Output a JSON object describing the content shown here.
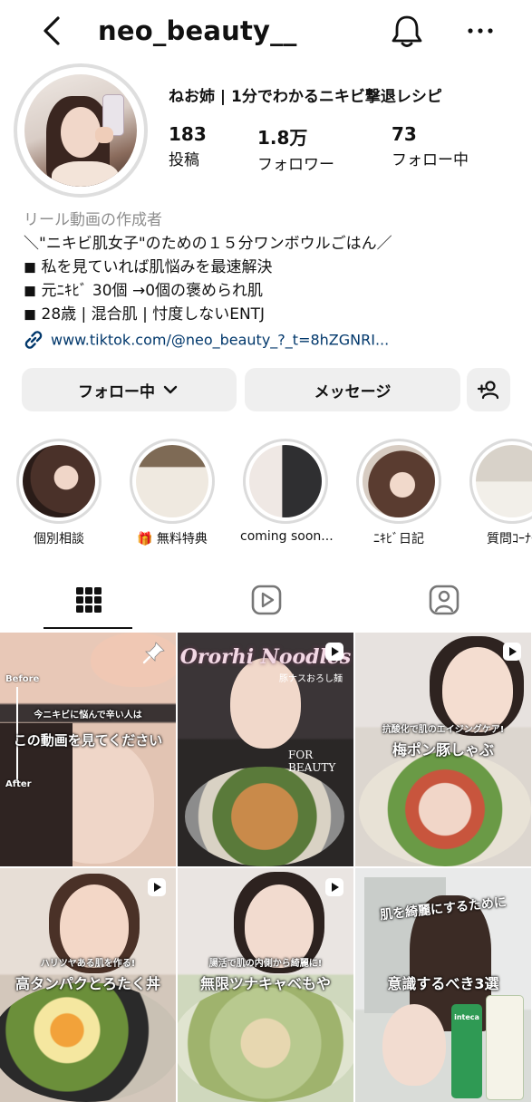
{
  "header": {
    "username": "neo_beauty__"
  },
  "profile": {
    "display_name": "ねお姉 | 1分でわかるニキビ撃退レシピ",
    "stats": [
      {
        "value": "183",
        "label": "投稿"
      },
      {
        "value": "1.8万",
        "label": "フォロワー"
      },
      {
        "value": "73",
        "label": "フォロー中"
      }
    ],
    "category": "リール動画の作成者",
    "bio_lines": [
      "＼\"ニキビ肌女子\"のための１５分ワンボウルごはん／",
      "◼︎ 私を見ていれば肌悩みを最速解決",
      "◼︎ 元ﾆｷﾋﾞ 30個 →0個の褒められ肌",
      "◼︎ 28歳 | 混合肌 | 忖度しないENTJ"
    ],
    "link": "www.tiktok.com/@neo_beauty_?_t=8hZGNRI..."
  },
  "buttons": {
    "following": "フォロー中",
    "message": "メッセージ"
  },
  "highlights": [
    {
      "label": "個別相談"
    },
    {
      "label": "🎁 無料特典"
    },
    {
      "label": "coming soon..."
    },
    {
      "label": "ﾆｷﾋﾞ日記"
    },
    {
      "label": "質問ｺｰﾅｰ"
    }
  ],
  "grid": [
    {
      "texts": [
        "Before",
        "今ニキビに悩んで辛い人は",
        "この動画を見てください",
        "After"
      ]
    },
    {
      "texts": [
        "Ororhi Noodles",
        "豚ナスおろし麺",
        "FOR BEAUTY"
      ]
    },
    {
      "texts": [
        "抗酸化で肌のエイジングケア!",
        "梅ポン豚しゃぶ"
      ]
    },
    {
      "texts": [
        "ハリツヤある肌を作る!",
        "高タンパクとろたく丼"
      ]
    },
    {
      "texts": [
        "腸活で肌の内側から綺麗に!",
        "無限ツナキャベもや"
      ]
    },
    {
      "texts": [
        "肌を綺麗にするために",
        "意識するべき3選",
        "inteca"
      ]
    }
  ],
  "colors": {
    "link": "#00376b",
    "button_bg": "#efefef",
    "category": "#8e8e8e"
  }
}
